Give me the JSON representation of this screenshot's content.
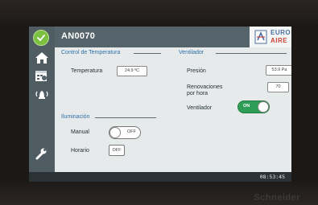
{
  "header": {
    "title": "AN0070",
    "brand_line1": "EURO",
    "brand_line2": "AIRE"
  },
  "temperature_section": {
    "title": "Control de Temperatura",
    "temperature_label": "Temperatura",
    "temperature_value": "24.9 ºC"
  },
  "ventilation_section": {
    "title": "Ventilador",
    "pressure_label": "Presión",
    "pressure_value": "53.9 Pa",
    "renewals_label_line1": "Renovaciones",
    "renewals_label_line2": "por hora",
    "renewals_value": "70",
    "fan_label": "Ventilador",
    "fan_state": "ON"
  },
  "lighting_section": {
    "title": "Iluminación",
    "manual_label": "Manual",
    "manual_state": "OFF",
    "schedule_label": "Horario",
    "schedule_state": "OFF"
  },
  "status_bar": {
    "time": "08:53:45"
  },
  "bezel": {
    "brand": "Schneider"
  },
  "colors": {
    "accent_green": "#2e9d55",
    "status_green": "#7cc042",
    "header": "#55636a",
    "section_title": "#2f6fa8"
  },
  "icons": [
    "check-icon",
    "home-icon",
    "schedule-icon",
    "alarm-icon",
    "wrench-icon",
    "euroaire-logo-icon"
  ]
}
